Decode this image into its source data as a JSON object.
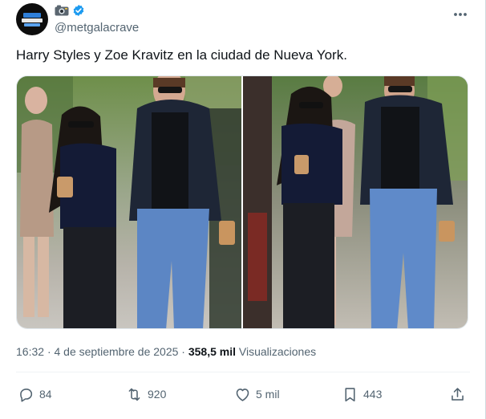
{
  "author": {
    "handle": "@metgalacrave",
    "avatar_icon": "metgala-logo-avatar",
    "display_name_icon": "camera-emoji-icon",
    "verified_icon": "verified-badge-icon",
    "verified_color": "#1d9bf0"
  },
  "tweet": {
    "text": "Harry Styles y Zoe Kravitz en la ciudad de Nueva York."
  },
  "meta": {
    "time": "16:32",
    "separator": "·",
    "date": "4 de septiembre de 2025",
    "views_count": "358,5 mil",
    "views_label": "Visualizaciones"
  },
  "actions": {
    "replies": "84",
    "reposts": "920",
    "likes": "5 mil",
    "bookmarks": "443"
  },
  "colors": {
    "text": "#0f1419",
    "secondary": "#536471",
    "border": "#eff3f4"
  }
}
